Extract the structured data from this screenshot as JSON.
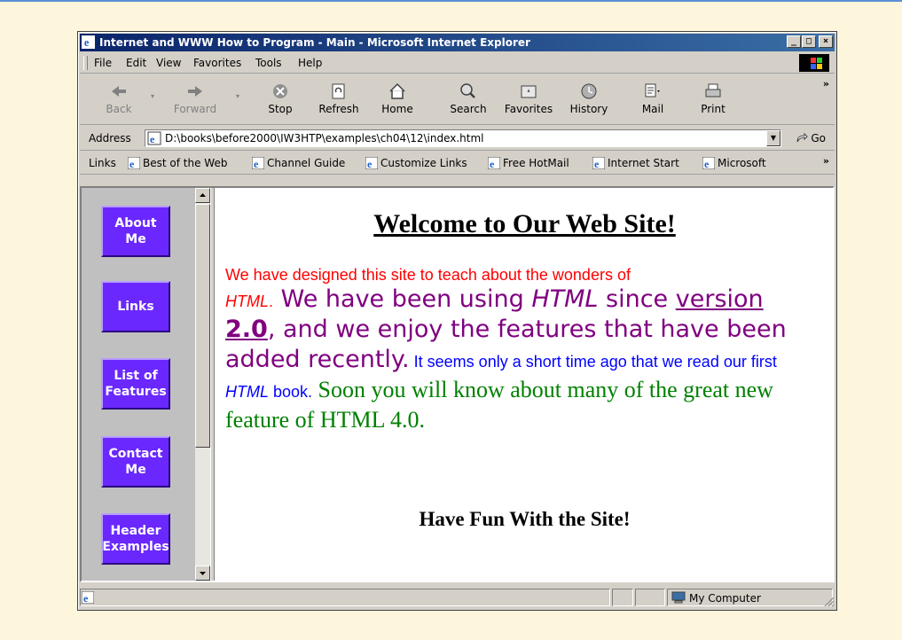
{
  "window": {
    "title": "Internet and WWW How to Program - Main - Microsoft Internet Explorer",
    "buttons": {
      "minimize": "_",
      "maximize": "□",
      "close": "×"
    }
  },
  "menubar": {
    "items": [
      "File",
      "Edit",
      "View",
      "Favorites",
      "Tools",
      "Help"
    ]
  },
  "toolbar": {
    "back": "Back",
    "forward": "Forward",
    "stop": "Stop",
    "refresh": "Refresh",
    "home": "Home",
    "search": "Search",
    "favorites": "Favorites",
    "history": "History",
    "mail": "Mail",
    "print": "Print",
    "more": "»"
  },
  "address": {
    "label": "Address",
    "url": "D:\\books\\before2000\\IW3HTP\\examples\\ch04\\12\\index.html",
    "go": "Go"
  },
  "links": {
    "label": "Links",
    "items": [
      "Best of the Web",
      "Channel Guide",
      "Customize Links",
      "Free HotMail",
      "Internet Start",
      "Microsoft"
    ],
    "more": "»"
  },
  "nav": {
    "buttons": [
      "About Me",
      "Links",
      "List of Features",
      "Contact Me",
      "Header Examples"
    ]
  },
  "page": {
    "heading": "Welcome to Our Web Site!",
    "red_text": "We have designed this site to teach about the wonders of",
    "red_html": "HTML",
    "red_end": ".",
    "purple_1": " We have been using ",
    "purple_html": "HTML",
    "purple_2": " since ",
    "purple_link": "version ",
    "purple_link_bold": "2.0",
    "purple_3": ", and we enjoy the features that have been added recently.",
    "blue_1": " It seems only a short time ago that we read our first ",
    "blue_html": "HTML",
    "blue_2": " book.",
    "green": " Soon you will know about many of the great new feature of HTML 4.0.",
    "footer": "Have Fun With the Site!"
  },
  "status": {
    "zone": "My Computer"
  },
  "colors": {
    "nav_button": "#6a28ff",
    "red": "#ff0000",
    "purple": "#800080",
    "blue": "#0000ff",
    "green": "#008000"
  }
}
